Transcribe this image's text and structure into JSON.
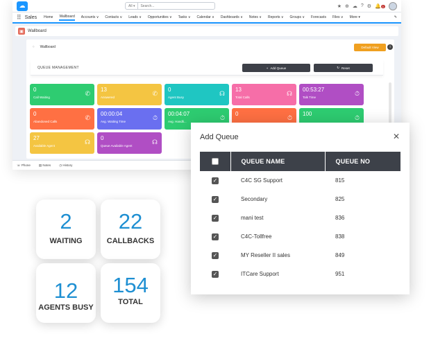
{
  "topbar": {
    "search_scope": "All ▾",
    "search_placeholder": "Search...",
    "notification_count": "1"
  },
  "navbar": {
    "app_name": "Sales",
    "items": [
      "Home",
      "Wallboard",
      "Accounts ∨",
      "Contacts ∨",
      "Leads ∨",
      "Opportunities ∨",
      "Tasks ∨",
      "Calendar ∨",
      "Dashboards ∨",
      "Notes ∨",
      "Reports ∨",
      "Groups ∨",
      "Forecasts",
      "Files ∨",
      "More ▾"
    ]
  },
  "page": {
    "title": "Wallboard"
  },
  "board": {
    "title": "Wallboard",
    "default_view": "Default View",
    "queue_management": "QUEUE MANAGEMENT",
    "add_queue": "Add Queue",
    "reset": "Reset",
    "tiles": [
      {
        "value": "0",
        "label": "Call Waiting",
        "color": "#2ecc71",
        "icon": "phone-icon"
      },
      {
        "value": "13",
        "label": "Answered",
        "color": "#f4c542",
        "icon": "phone-icon"
      },
      {
        "value": "0",
        "label": "Agent Busy",
        "color": "#1fc6c2",
        "icon": "headset-icon"
      },
      {
        "value": "13",
        "label": "Total Calls",
        "color": "#f66ea8",
        "icon": "headset-icon"
      },
      {
        "value": "00:53:27",
        "label": "Talk Time",
        "color": "#b04ec4",
        "icon": "timer-icon"
      },
      {
        "value": "0",
        "label": "Abandoned Calls",
        "color": "#ff7043",
        "icon": "missed-call-icon"
      },
      {
        "value": "00:00:04",
        "label": "Avg. Waiting Time",
        "color": "#6a6ff0",
        "icon": "timer-icon"
      },
      {
        "value": "00:04:07",
        "label": "Avg. Handli...",
        "color": "#2ecc71",
        "icon": "timer-icon"
      },
      {
        "value": "0",
        "label": "",
        "color": "#ff7043",
        "icon": "timer-icon"
      },
      {
        "value": "100",
        "label": "",
        "color": "#2ecc71",
        "icon": "timer-icon"
      },
      {
        "value": "27",
        "label": "Available Agent",
        "color": "#f4c542",
        "icon": "headset-icon"
      },
      {
        "value": "0",
        "label": "Queue Available Agent",
        "color": "#b04ec4",
        "icon": "headset-icon"
      }
    ]
  },
  "footer": {
    "items": [
      "Phone",
      "Notes",
      "History"
    ]
  },
  "modal": {
    "title": "Add Queue",
    "columns": [
      "QUEUE NAME",
      "QUEUE NO"
    ],
    "rows": [
      {
        "name": "C4C SG Support",
        "no": "815",
        "checked": true
      },
      {
        "name": "Secondary",
        "no": "825",
        "checked": true
      },
      {
        "name": "mani test",
        "no": "836",
        "checked": true
      },
      {
        "name": "C4C-Tollfree",
        "no": "838",
        "checked": true
      },
      {
        "name": "MY Reseller II sales",
        "no": "849",
        "checked": true
      },
      {
        "name": "ITCare Support",
        "no": "951",
        "checked": true
      }
    ]
  },
  "stats": [
    {
      "value": "2",
      "label": "WAITING"
    },
    {
      "value": "22",
      "label": "CALLBACKS"
    },
    {
      "value": "12",
      "label": "AGENTS BUSY"
    },
    {
      "value": "154",
      "label": "TOTAL"
    }
  ]
}
